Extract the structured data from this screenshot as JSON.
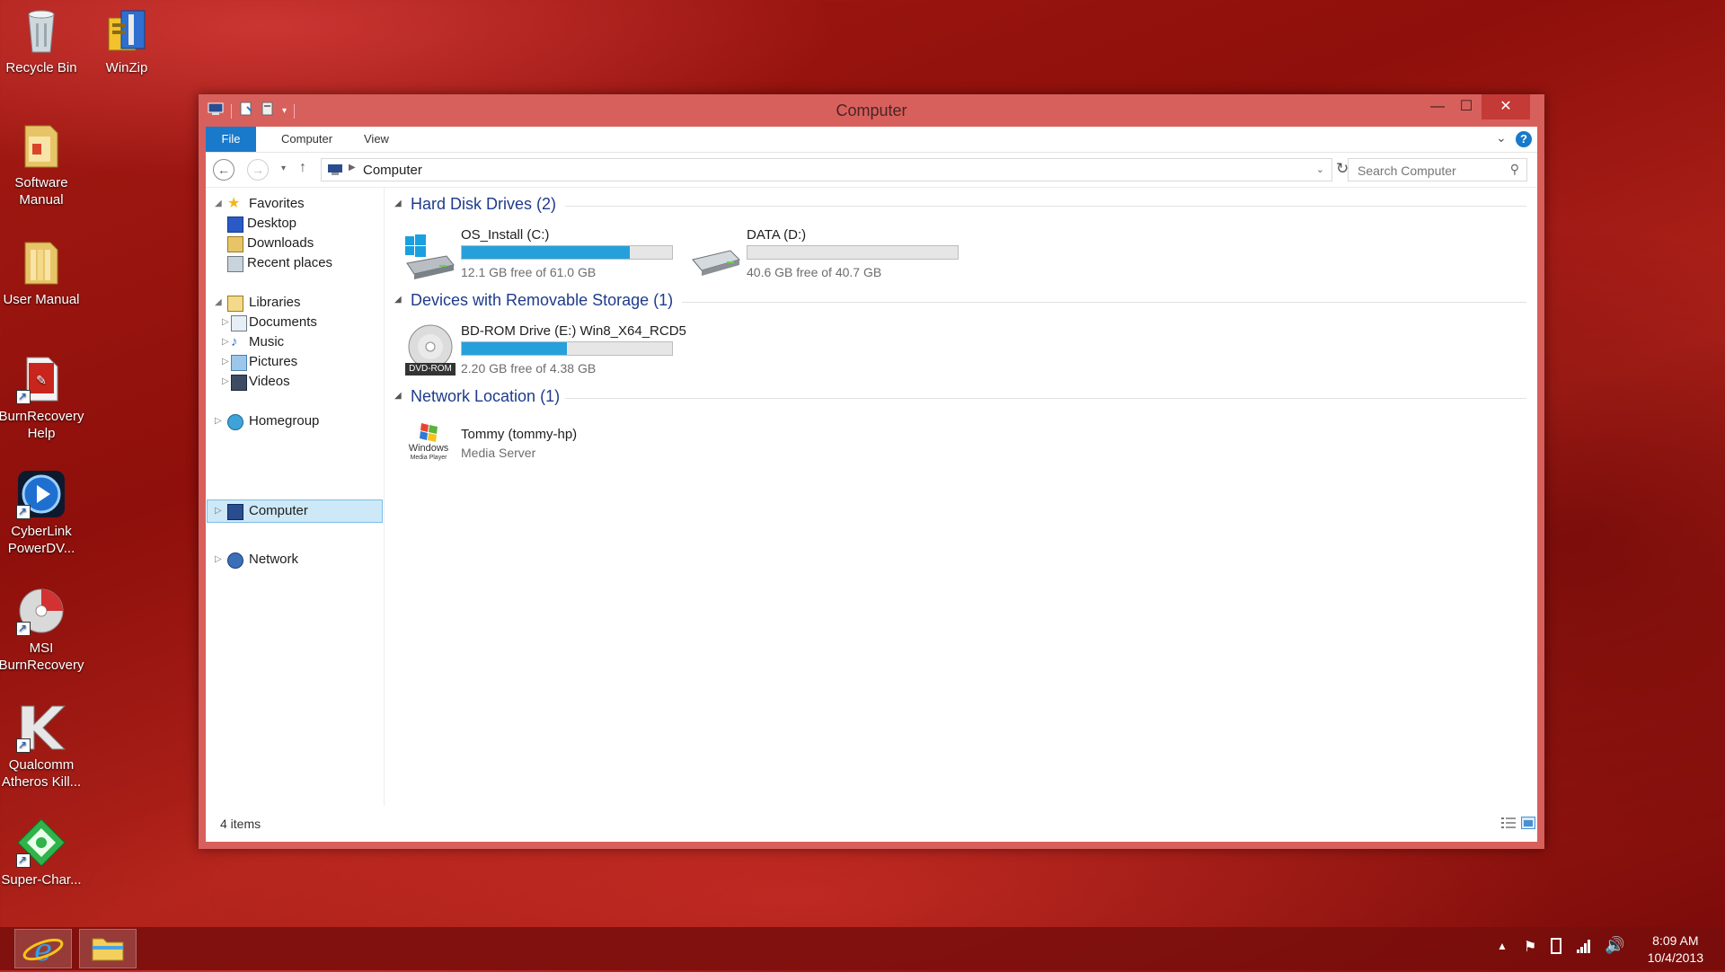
{
  "desktop": {
    "icons": [
      {
        "label": "Recycle Bin",
        "icon": "recycle-bin-icon"
      },
      {
        "label": "WinZip",
        "icon": "winzip-icon"
      },
      {
        "label": "Software Manual",
        "icon": "folder-icon"
      },
      {
        "label": "User Manual",
        "icon": "folder-icon"
      },
      {
        "label": "BurnRecovery Help",
        "icon": "pdf-icon"
      },
      {
        "label": "CyberLink PowerDV...",
        "icon": "powerdvd-icon"
      },
      {
        "label": "MSI BurnRecovery",
        "icon": "disc-icon"
      },
      {
        "label": "Qualcomm Atheros Kill...",
        "icon": "killer-icon"
      },
      {
        "label": "Super-Char...",
        "icon": "super-charger-icon"
      }
    ]
  },
  "window": {
    "title": "Computer",
    "controls": {
      "minimize": "—",
      "maximize": "☐",
      "close": "✕"
    }
  },
  "ribbon": {
    "tabs": [
      "File",
      "Computer",
      "View"
    ]
  },
  "address": {
    "crumb": "Computer",
    "search_placeholder": "Search Computer"
  },
  "nav": {
    "favorites": {
      "label": "Favorites",
      "items": [
        "Desktop",
        "Downloads",
        "Recent places"
      ]
    },
    "libraries": {
      "label": "Libraries",
      "items": [
        "Documents",
        "Music",
        "Pictures",
        "Videos"
      ]
    },
    "homegroup": "Homegroup",
    "computer": "Computer",
    "network": "Network"
  },
  "content": {
    "hdd": {
      "header": "Hard Disk Drives (2)",
      "drives": [
        {
          "name": "OS_Install (C:)",
          "free": "12.1 GB free of 61.0 GB",
          "used_fraction": 0.8
        },
        {
          "name": "DATA (D:)",
          "free": "40.6 GB free of 40.7 GB",
          "used_fraction": 0.0
        }
      ]
    },
    "removable": {
      "header": "Devices with Removable Storage (1)",
      "drive": {
        "name": "BD-ROM Drive (E:) Win8_X64_RCD5",
        "free": "2.20 GB free of 4.38 GB",
        "used_fraction": 0.5,
        "badge": "DVD-ROM"
      }
    },
    "network": {
      "header": "Network Location (1)",
      "item": {
        "name": "Tommy (tommy-hp)",
        "sub": "Media Server",
        "logo_text": "Windows",
        "logo_sub": "Media Player"
      }
    }
  },
  "status": {
    "items": "4 items"
  },
  "taskbar": {
    "time": "8:09 AM",
    "date": "10/4/2013"
  },
  "colors": {
    "accent": "#1979ca",
    "window_frame": "#d8605c",
    "bar_fill": "#26a0da",
    "group_header": "#1e3b8c"
  }
}
